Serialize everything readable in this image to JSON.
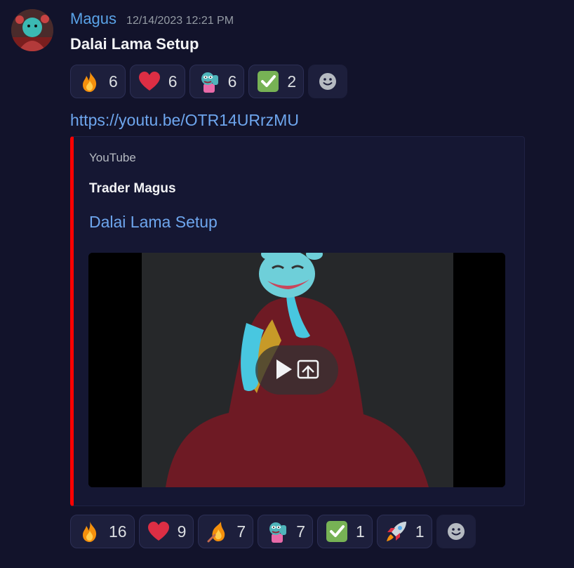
{
  "message": {
    "username": "Magus",
    "timestamp": "12/14/2023 12:21 PM",
    "title": "Dalai Lama Setup",
    "link": "https://youtu.be/OTR14URrzMU",
    "colors": {
      "username": "#5aa3e8",
      "link": "#6ea6ee",
      "embed_accent": "#ff0000",
      "background": "#12132b"
    }
  },
  "reactions_top": [
    {
      "icon": "fire-emoji",
      "count": "6"
    },
    {
      "icon": "heart-emoji",
      "count": "6"
    },
    {
      "icon": "pepe-emoji",
      "count": "6"
    },
    {
      "icon": "check-emoji",
      "count": "2"
    }
  ],
  "embed": {
    "provider": "YouTube",
    "author": "Trader Magus",
    "title": "Dalai Lama Setup",
    "thumbnail": "pepe-meditating-monk-thumbnail"
  },
  "reactions_bottom": [
    {
      "icon": "fire-emoji",
      "count": "16"
    },
    {
      "icon": "heart-emoji",
      "count": "9"
    },
    {
      "icon": "flame-emoji",
      "count": "7"
    },
    {
      "icon": "pepe-emoji",
      "count": "7"
    },
    {
      "icon": "check-emoji",
      "count": "1"
    },
    {
      "icon": "rocket-emoji",
      "count": "1"
    }
  ]
}
